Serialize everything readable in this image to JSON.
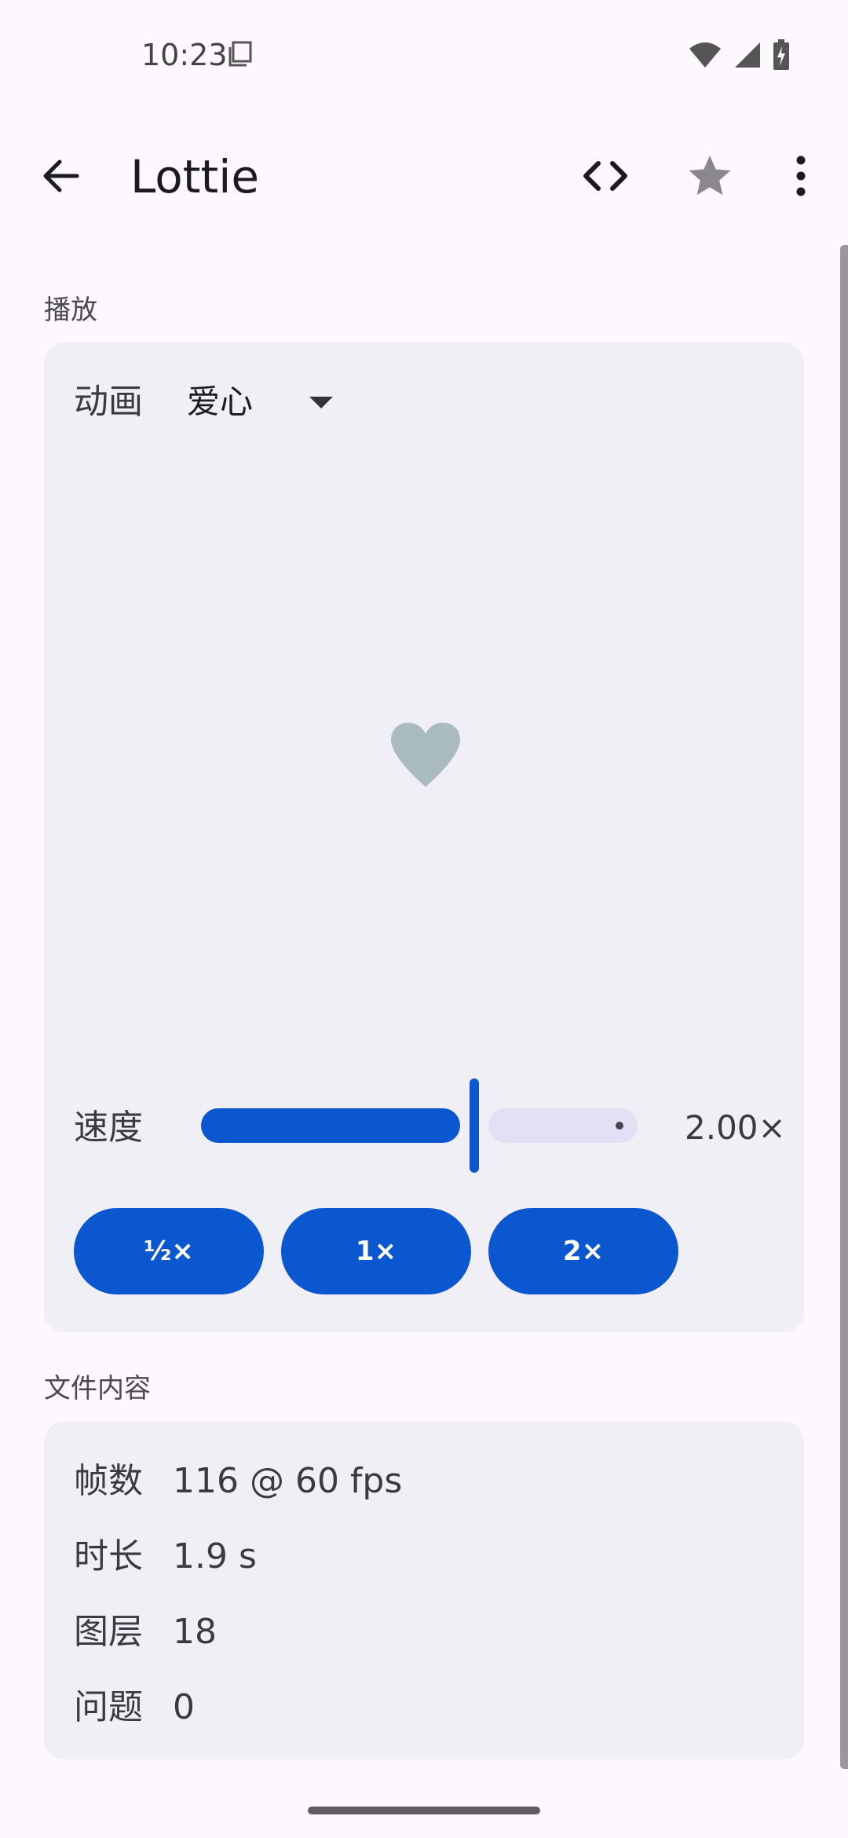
{
  "status_bar": {
    "time": "10:23"
  },
  "app_bar": {
    "title": "Lottie",
    "icons": [
      "back-arrow-icon",
      "code-icon",
      "star-icon",
      "more-vert-icon"
    ]
  },
  "playback": {
    "section_label": "播放",
    "animation_label": "动画",
    "animation_selected": "爱心",
    "speed_label": "速度",
    "speed_value": "2.00×",
    "speed_slider_fraction": 0.6,
    "presets": [
      "½×",
      "1×",
      "2×"
    ]
  },
  "file_contents": {
    "section_label": "文件内容",
    "rows": [
      {
        "key": "帧数",
        "value": "116 @ 60 fps"
      },
      {
        "key": "时长",
        "value": "1.9 s"
      },
      {
        "key": "图层",
        "value": "18"
      },
      {
        "key": "问题",
        "value": "0"
      }
    ]
  },
  "colors": {
    "accent": "#0b57d0",
    "card_bg": "#f1eff6",
    "page_bg": "#fdf8fd",
    "heart": "#a9bbc1"
  }
}
